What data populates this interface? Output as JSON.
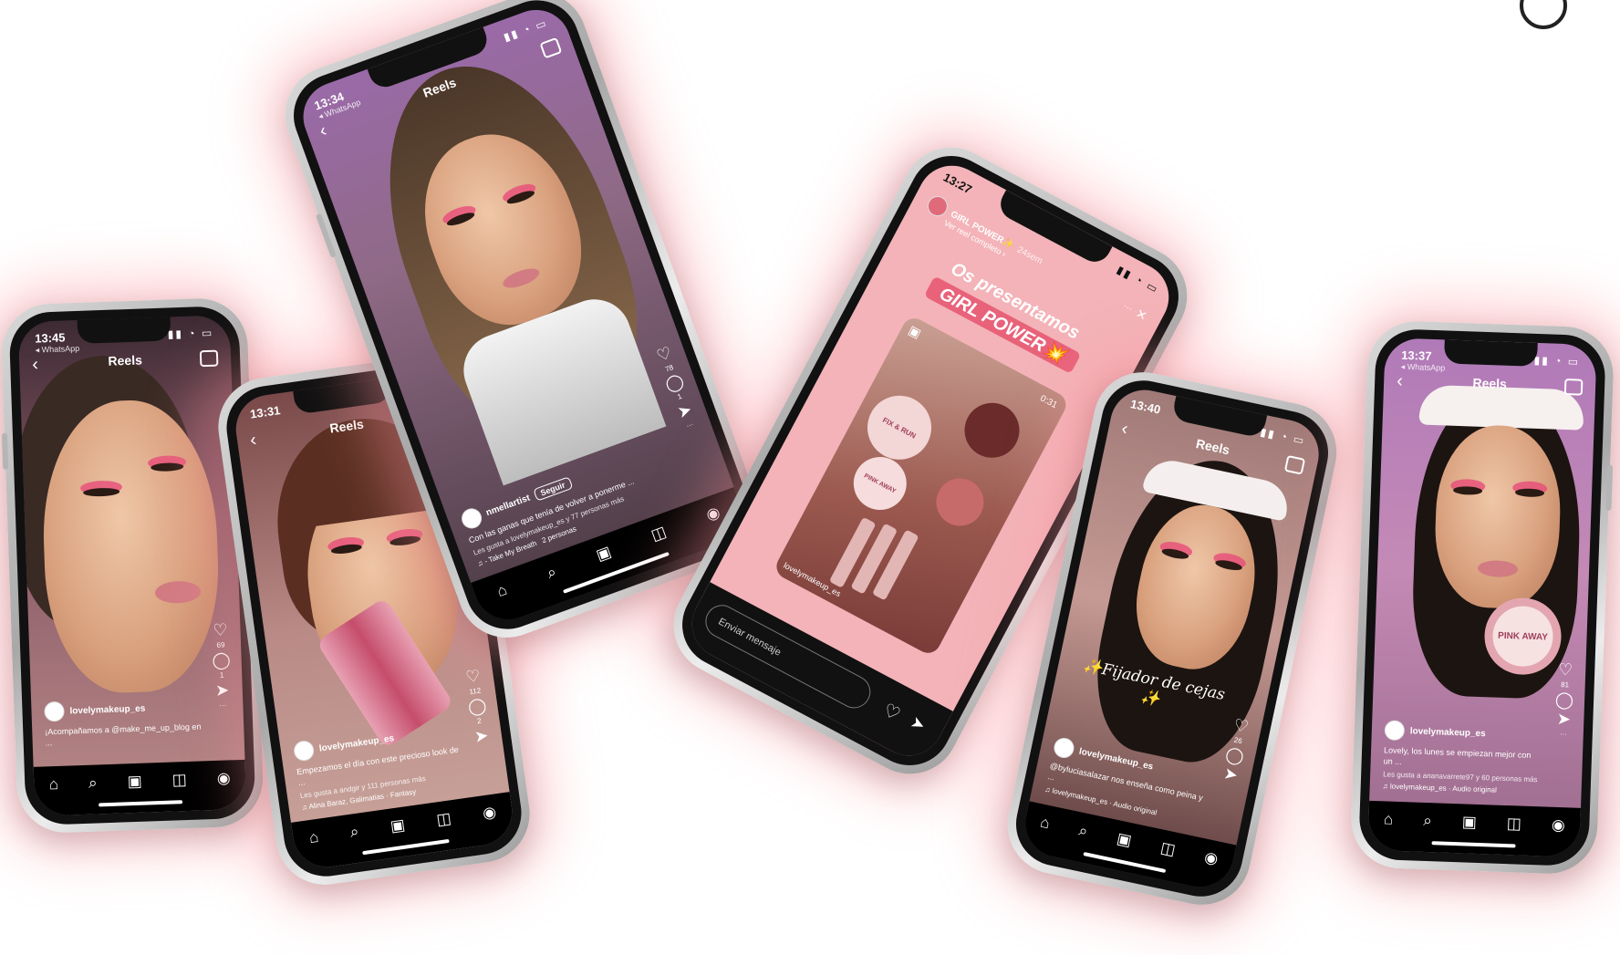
{
  "colors": {
    "accent_pink": "#ff9aa8",
    "story_bg": "#f3b3b8",
    "nav_bg": "#000000"
  },
  "icons": {
    "back": "‹",
    "heart": "♡",
    "comment": "◯",
    "share": "➤",
    "more": "···",
    "home": "⌂",
    "search": "⌕",
    "reels": "▣",
    "shop": "◫",
    "profile": "◉",
    "music": "♫",
    "close": "✕"
  },
  "phone1": {
    "time": "13:45",
    "back_app": "◂ WhatsApp",
    "title": "Reels",
    "likes_count": "69",
    "comments_count": "1",
    "user": "lovelymakeup_es",
    "caption": "¡Acompañamos a @make_me_up_blog en ..."
  },
  "phone2": {
    "time": "13:31",
    "title": "Reels",
    "likes_count": "112",
    "comments_count": "2",
    "user": "lovelymakeup_es",
    "caption": "Empezamos el día con este precioso look de ...",
    "liked_by": "Les gusta a andgir y 111 personas más",
    "audio": "Alina Baraz, Galimatias · Fantasy"
  },
  "phone3": {
    "time": "13:34",
    "back_app": "◂ WhatsApp",
    "title": "Reels",
    "likes_count": "78",
    "comments_count": "1",
    "user": "nmellartist",
    "follow": "Seguir",
    "caption": "Con las ganas que tenía de volver a ponerme ...",
    "liked_by": "Les gusta a lovelymakeup_es y 77 personas más",
    "audio": "- Take My Breath",
    "people": "2 personas"
  },
  "phone4": {
    "time": "13:27",
    "story_title": "GIRL POWER✨",
    "story_age": "24sem",
    "story_link": "Ver reel completo ›",
    "headline1": "Os presentamos",
    "headline2": "GIRL POWER💥",
    "video_time": "0:31",
    "product1": "FIX & RUN",
    "product2": "PINK AWAY",
    "reel_user": "lovelymakeup_es",
    "message_placeholder": "Enviar mensaje"
  },
  "phone5": {
    "time": "13:40",
    "title": "Reels",
    "likes_count": "26",
    "overlay_text": "✨Fijador de cejas ✨",
    "user": "lovelymakeup_es",
    "caption": "@byluciasalazar nos enseña como peina y ...",
    "audio": "lovelymakeup_es · Audio original"
  },
  "phone6": {
    "time": "13:37",
    "back_app": "◂ WhatsApp",
    "title": "Reels",
    "likes_count": "81",
    "product": "PINK AWAY",
    "user": "lovelymakeup_es",
    "caption": "Lovely, los lunes se empiezan mejor con un ...",
    "liked_by": "Les gusta a ananavarrete97 y 60 personas más",
    "audio": "lovelymakeup_es · Audio original"
  }
}
